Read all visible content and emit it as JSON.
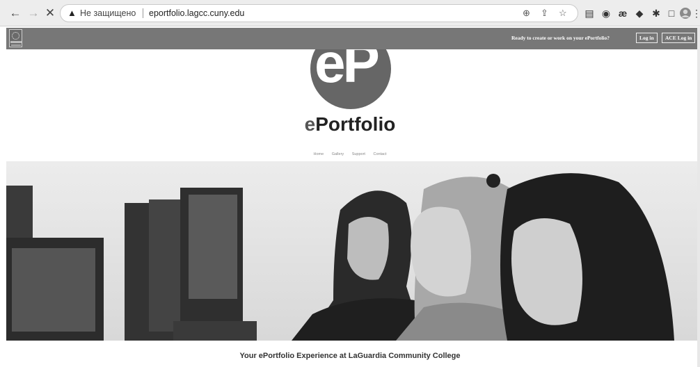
{
  "browser": {
    "security_label": "Не защищено",
    "url": "eportfolio.lagcc.cuny.edu",
    "icons": [
      "back-icon",
      "forward-icon",
      "stop-icon",
      "warning-icon",
      "zoom-icon",
      "share-icon",
      "star-icon",
      "extension-icons",
      "side-panel-icon",
      "profile-avatar-icon",
      "more-menu-icon"
    ]
  },
  "topbar": {
    "prompt": "Ready to create or work on your ePortfolio?",
    "login": "Log in",
    "ace_login": "ACE Log in"
  },
  "brand": {
    "logo_letters": "eP",
    "wordmark_prefix": "e",
    "wordmark_rest": "Portfolio"
  },
  "nav": [
    "Home",
    "Gallery",
    "Support",
    "Contact"
  ],
  "hero_caption": "Your ePortfolio Experience at LaGuardia Community College"
}
